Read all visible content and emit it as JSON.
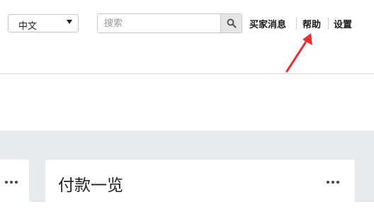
{
  "header": {
    "language_select": {
      "value": "中文"
    },
    "search": {
      "placeholder": "搜索"
    },
    "links": {
      "buyer_messages": "买家消息",
      "help": "帮助",
      "settings": "设置"
    }
  },
  "annotation": {
    "arrow_color": "#e63232"
  },
  "main": {
    "card": {
      "title": "付款一览"
    }
  }
}
